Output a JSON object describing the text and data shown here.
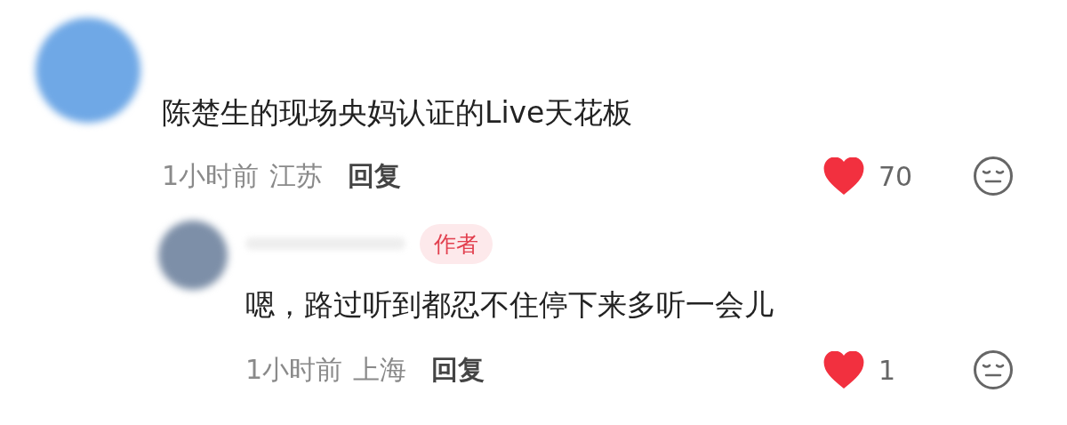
{
  "comments": [
    {
      "color": "#6fa8e6",
      "text": "陈楚生的现场央妈认证的Live天花板",
      "time": "1小时前",
      "location": "江苏",
      "reply_label": "回复",
      "liked": true,
      "like_count": "70",
      "replies": [
        {
          "color": "#7d8fa8",
          "badge": "作者",
          "text": "嗯，路过听到都忍不住停下来多听一会儿",
          "time": "1小时前",
          "location": "上海",
          "reply_label": "回复",
          "liked": true,
          "like_count": "1"
        }
      ]
    }
  ]
}
